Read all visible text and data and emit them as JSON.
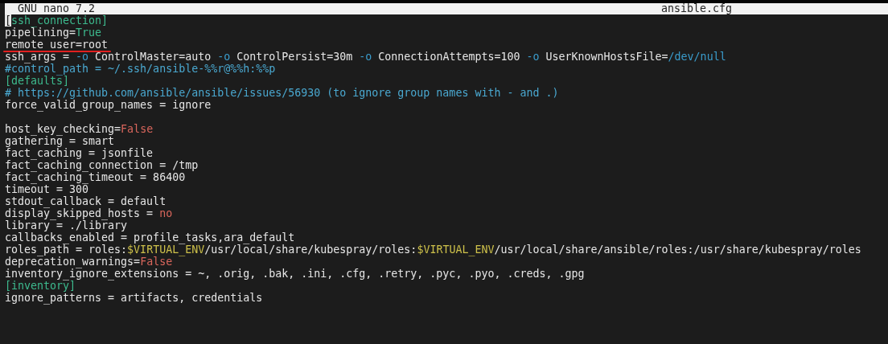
{
  "title_bar": {
    "app": "GNU nano 7.2",
    "filename": "ansible.cfg"
  },
  "lines": [
    {
      "kind": "text",
      "cursor": true,
      "segments": [
        {
          "kind": "plain",
          "text": "["
        },
        {
          "kind": "section",
          "text": "ssh_connection]"
        }
      ]
    },
    {
      "kind": "text",
      "segments": [
        {
          "kind": "plain",
          "text": "pipelining="
        },
        {
          "kind": "true",
          "text": "True"
        }
      ]
    },
    {
      "kind": "text",
      "underlined": true,
      "segments": [
        {
          "kind": "plain",
          "text": "remote_user=root"
        }
      ]
    },
    {
      "kind": "text",
      "segments": [
        {
          "kind": "plain",
          "text": "ssh_args = "
        },
        {
          "kind": "flag",
          "text": "-o"
        },
        {
          "kind": "plain",
          "text": " ControlMaster=auto "
        },
        {
          "kind": "flag",
          "text": "-o"
        },
        {
          "kind": "plain",
          "text": " ControlPersist=30m "
        },
        {
          "kind": "flag",
          "text": "-o"
        },
        {
          "kind": "plain",
          "text": " ConnectionAttempts=100 "
        },
        {
          "kind": "flag",
          "text": "-o"
        },
        {
          "kind": "plain",
          "text": " UserKnownHostsFile="
        },
        {
          "kind": "path",
          "text": "/dev/null"
        }
      ]
    },
    {
      "kind": "text",
      "segments": [
        {
          "kind": "comment",
          "text": "#control_path = ~/.ssh/ansible-%%r@%%h:%%p"
        }
      ]
    },
    {
      "kind": "text",
      "segments": [
        {
          "kind": "section",
          "text": "[defaults]"
        }
      ]
    },
    {
      "kind": "text",
      "segments": [
        {
          "kind": "comment",
          "text": "# https://github.com/ansible/ansible/issues/56930 (to ignore group names with - and .)"
        }
      ]
    },
    {
      "kind": "text",
      "segments": [
        {
          "kind": "plain",
          "text": "force_valid_group_names = ignore"
        }
      ]
    },
    {
      "kind": "blank"
    },
    {
      "kind": "text",
      "segments": [
        {
          "kind": "plain",
          "text": "host_key_checking="
        },
        {
          "kind": "false",
          "text": "False"
        }
      ]
    },
    {
      "kind": "text",
      "segments": [
        {
          "kind": "plain",
          "text": "gathering = smart"
        }
      ]
    },
    {
      "kind": "text",
      "segments": [
        {
          "kind": "plain",
          "text": "fact_caching = jsonfile"
        }
      ]
    },
    {
      "kind": "text",
      "segments": [
        {
          "kind": "plain",
          "text": "fact_caching_connection = /tmp"
        }
      ]
    },
    {
      "kind": "text",
      "segments": [
        {
          "kind": "plain",
          "text": "fact_caching_timeout = 86400"
        }
      ]
    },
    {
      "kind": "text",
      "segments": [
        {
          "kind": "plain",
          "text": "timeout = 300"
        }
      ]
    },
    {
      "kind": "text",
      "segments": [
        {
          "kind": "plain",
          "text": "stdout_callback = default"
        }
      ]
    },
    {
      "kind": "text",
      "segments": [
        {
          "kind": "plain",
          "text": "display_skipped_hosts = "
        },
        {
          "kind": "false",
          "text": "no"
        }
      ]
    },
    {
      "kind": "text",
      "segments": [
        {
          "kind": "plain",
          "text": "library = ./library"
        }
      ]
    },
    {
      "kind": "text",
      "segments": [
        {
          "kind": "plain",
          "text": "callbacks_enabled = profile_tasks,ara_default"
        }
      ]
    },
    {
      "kind": "text",
      "segments": [
        {
          "kind": "plain",
          "text": "roles_path = roles:"
        },
        {
          "kind": "env",
          "text": "$VIRTUAL_ENV"
        },
        {
          "kind": "plain",
          "text": "/usr/local/share/kubespray/roles:"
        },
        {
          "kind": "env",
          "text": "$VIRTUAL_ENV"
        },
        {
          "kind": "plain",
          "text": "/usr/local/share/ansible/roles:/usr/share/kubespray/roles"
        }
      ]
    },
    {
      "kind": "text",
      "segments": [
        {
          "kind": "plain",
          "text": "deprecation_warnings="
        },
        {
          "kind": "false",
          "text": "False"
        }
      ]
    },
    {
      "kind": "text",
      "segments": [
        {
          "kind": "plain",
          "text": "inventory_ignore_extensions = ~, .orig, .bak, .ini, .cfg, .retry, .pyc, .pyo, .creds, .gpg"
        }
      ]
    },
    {
      "kind": "text",
      "segments": [
        {
          "kind": "section",
          "text": "[inventory]"
        }
      ]
    },
    {
      "kind": "text",
      "segments": [
        {
          "kind": "plain",
          "text": "ignore_patterns = artifacts, credentials"
        }
      ]
    }
  ]
}
